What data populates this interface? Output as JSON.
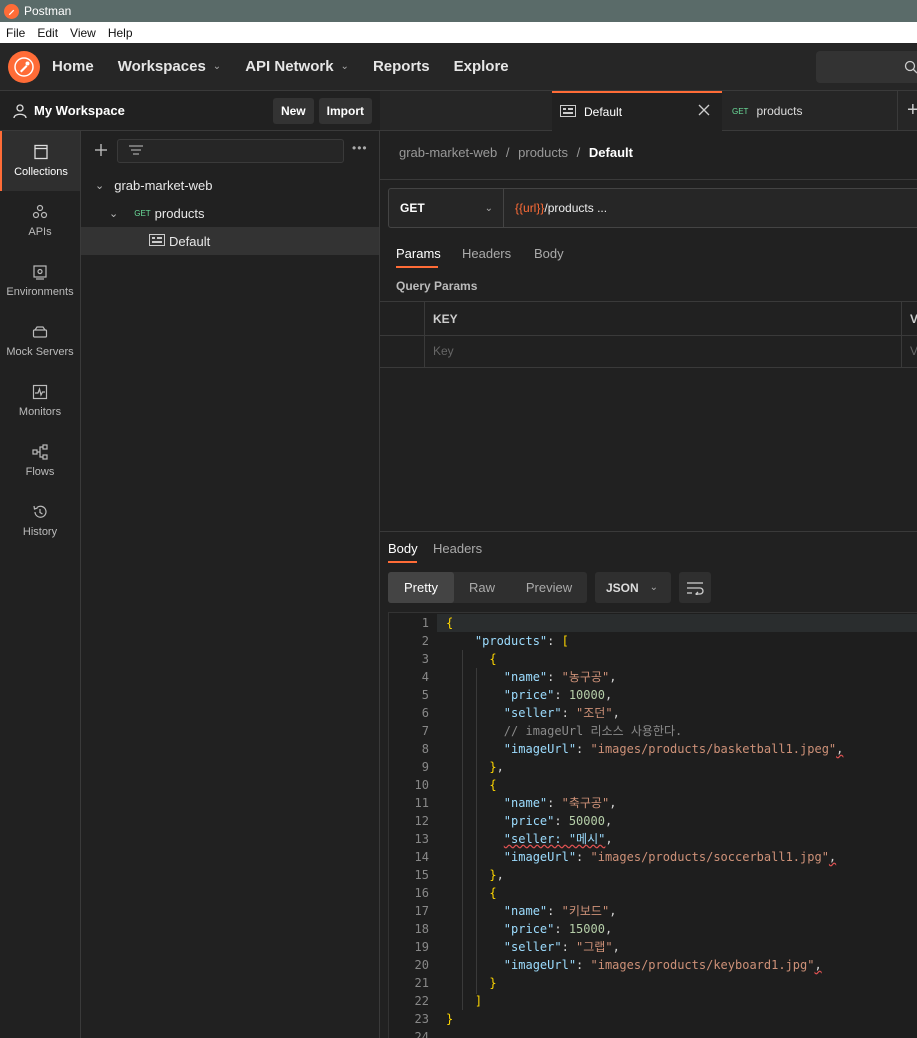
{
  "window": {
    "title": "Postman"
  },
  "menu": [
    "File",
    "Edit",
    "View",
    "Help"
  ],
  "nav": {
    "home": "Home",
    "workspaces": "Workspaces",
    "api_network": "API Network",
    "reports": "Reports",
    "explore": "Explore"
  },
  "workspace": {
    "title": "My Workspace",
    "new_label": "New",
    "import_label": "Import"
  },
  "rail": [
    {
      "label": "Collections",
      "icon": "collections-icon"
    },
    {
      "label": "APIs",
      "icon": "apis-icon"
    },
    {
      "label": "Environments",
      "icon": "environments-icon"
    },
    {
      "label": "Mock Servers",
      "icon": "mock-servers-icon"
    },
    {
      "label": "Monitors",
      "icon": "monitors-icon"
    },
    {
      "label": "Flows",
      "icon": "flows-icon"
    },
    {
      "label": "History",
      "icon": "history-icon"
    }
  ],
  "tree": {
    "collection": "grab-market-web",
    "request_method": "GET",
    "request_name": "products",
    "example": "Default"
  },
  "tabs": [
    {
      "label": "Default",
      "active": true
    },
    {
      "method": "GET",
      "label": "products"
    }
  ],
  "breadcrumb": {
    "part1": "grab-market-web",
    "sep": "/",
    "part2": "products",
    "part3": "Default"
  },
  "request": {
    "method": "GET",
    "url_var": "{{url}}",
    "url_path": "/products ..."
  },
  "request_tabs": {
    "params": "Params",
    "headers": "Headers",
    "body": "Body"
  },
  "query_params": {
    "title": "Query Params",
    "col_key": "KEY",
    "col_value_partial": "V",
    "key_placeholder": "Key",
    "value_placeholder_partial": "V"
  },
  "response_tabs": {
    "body": "Body",
    "headers": "Headers"
  },
  "view_modes": {
    "pretty": "Pretty",
    "raw": "Raw",
    "preview": "Preview",
    "format": "JSON"
  },
  "code_lines": [
    {
      "n": "1"
    },
    {
      "n": "2"
    },
    {
      "n": "3"
    },
    {
      "n": "4"
    },
    {
      "n": "5"
    },
    {
      "n": "6"
    },
    {
      "n": "7"
    },
    {
      "n": "8"
    },
    {
      "n": "9"
    },
    {
      "n": "10"
    },
    {
      "n": "11"
    },
    {
      "n": "12"
    },
    {
      "n": "13"
    },
    {
      "n": "14"
    },
    {
      "n": "15"
    },
    {
      "n": "16"
    },
    {
      "n": "17"
    },
    {
      "n": "18"
    },
    {
      "n": "19"
    },
    {
      "n": "20"
    },
    {
      "n": "21"
    },
    {
      "n": "22"
    },
    {
      "n": "23"
    },
    {
      "n": "24"
    }
  ],
  "code": {
    "products_key": "\"products\"",
    "name_key": "\"name\"",
    "price_key": "\"price\"",
    "seller_key": "\"seller\"",
    "image_key": "\"imageUrl\"",
    "item1": {
      "name": "\"농구공\"",
      "price": "10000",
      "seller": "\"조던\"",
      "comment": "// imageUrl 리소스 사용한다.",
      "image": "\"images/products/basketball1.jpeg\""
    },
    "item2": {
      "name": "\"축구공\"",
      "price": "50000",
      "seller_bad": "\"seller: \"메시\"",
      "image": "\"images/products/soccerball1.jpg\""
    },
    "item3": {
      "name": "\"키보드\"",
      "price": "15000",
      "seller": "\"그랩\"",
      "image": "\"images/products/keyboard1.jpg\""
    }
  },
  "colors": {
    "accent": "#ff6c37",
    "get": "#6bdd9a",
    "url_var": "#ff6c37"
  }
}
